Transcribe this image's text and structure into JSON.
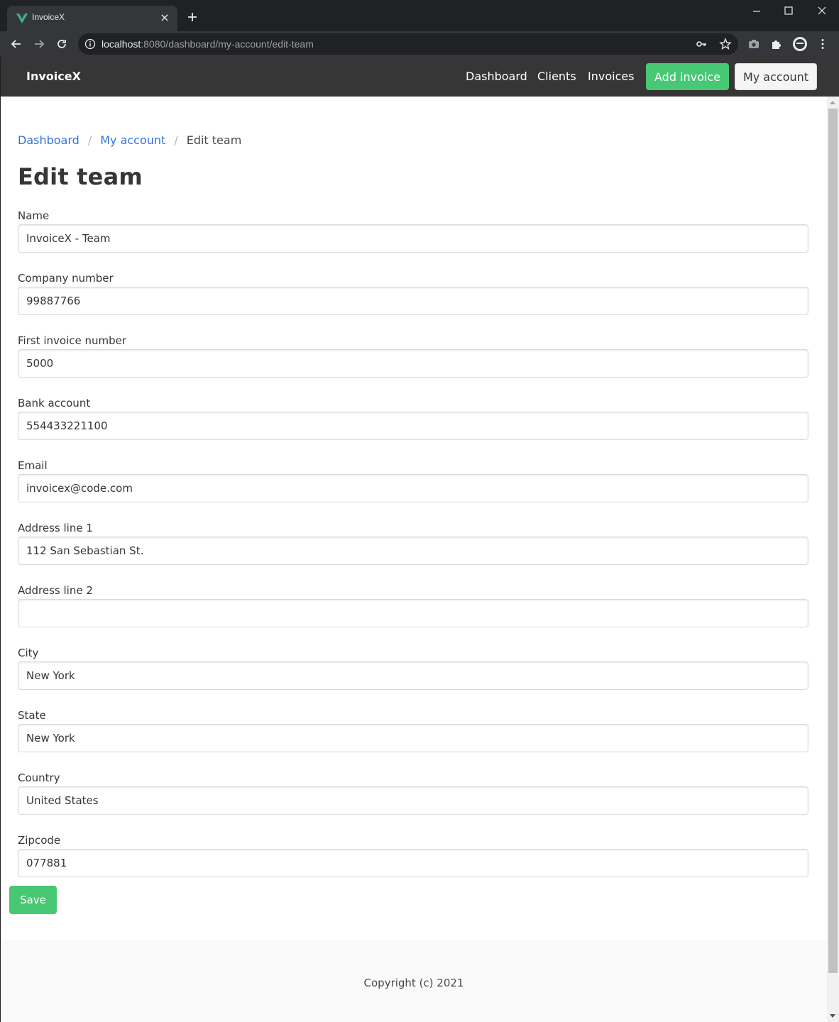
{
  "browser": {
    "tab_title": "InvoiceX",
    "url_host": "localhost",
    "url_rest": ":8080/dashboard/my-account/edit-team"
  },
  "navbar": {
    "brand": "InvoiceX",
    "links": [
      "Dashboard",
      "Clients",
      "Invoices"
    ],
    "add_invoice": "Add invoice",
    "my_account": "My account"
  },
  "breadcrumb": {
    "items": [
      "Dashboard",
      "My account",
      "Edit team"
    ],
    "separator": "/"
  },
  "page_title": "Edit team",
  "form": {
    "fields": [
      {
        "label": "Name",
        "value": "InvoiceX - Team"
      },
      {
        "label": "Company number",
        "value": "99887766"
      },
      {
        "label": "First invoice number",
        "value": "5000"
      },
      {
        "label": "Bank account",
        "value": "554433221100"
      },
      {
        "label": "Email",
        "value": "invoicex@code.com"
      },
      {
        "label": "Address line 1",
        "value": "112 San Sebastian St."
      },
      {
        "label": "Address line 2",
        "value": ""
      },
      {
        "label": "City",
        "value": "New York"
      },
      {
        "label": "State",
        "value": "New York"
      },
      {
        "label": "Country",
        "value": "United States"
      },
      {
        "label": "Zipcode",
        "value": "077881"
      }
    ],
    "save_label": "Save"
  },
  "footer": {
    "copyright": "Copyright (c) 2021"
  },
  "colors": {
    "primary_green": "#48c774",
    "link_blue": "#3273dc",
    "navbar_dark": "#363636"
  }
}
